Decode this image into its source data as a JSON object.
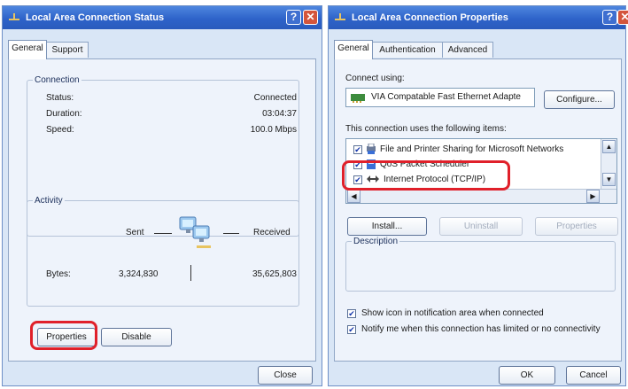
{
  "status_window": {
    "title": "Local Area Connection Status",
    "help": "?",
    "close": "✕",
    "tabs": [
      "General",
      "Support"
    ],
    "connection": {
      "legend": "Connection",
      "status_label": "Status:",
      "status_value": "Connected",
      "duration_label": "Duration:",
      "duration_value": "03:04:37",
      "speed_label": "Speed:",
      "speed_value": "100.0 Mbps"
    },
    "activity": {
      "legend": "Activity",
      "sent_label": "Sent",
      "received_label": "Received",
      "bytes_label": "Bytes:",
      "bytes_sent": "3,324,830",
      "bytes_received": "35,625,803"
    },
    "buttons": {
      "properties": "Properties",
      "disable": "Disable",
      "close": "Close"
    }
  },
  "properties_window": {
    "title": "Local Area Connection Properties",
    "help": "?",
    "close": "✕",
    "tabs": [
      "General",
      "Authentication",
      "Advanced"
    ],
    "connect_using_label": "Connect using:",
    "adapter_name": "VIA Compatable Fast Ethernet Adapte",
    "configure_button": "Configure...",
    "items_label": "This connection uses the following items:",
    "items": [
      {
        "label": "File and Printer Sharing for Microsoft Networks",
        "checked": true
      },
      {
        "label": "QoS Packet Scheduler",
        "checked": true
      },
      {
        "label": "Internet Protocol (TCP/IP)",
        "checked": true
      }
    ],
    "buttons": {
      "install": "Install...",
      "uninstall": "Uninstall",
      "properties": "Properties",
      "ok": "OK",
      "cancel": "Cancel"
    },
    "description_legend": "Description",
    "show_icon_label": "Show icon in notification area when connected",
    "notify_label": "Notify me when this connection has limited or no connectivity",
    "check_mark": "✔"
  },
  "colors": {
    "highlight": "#e0202a",
    "titlebar": "#2e63c9"
  }
}
